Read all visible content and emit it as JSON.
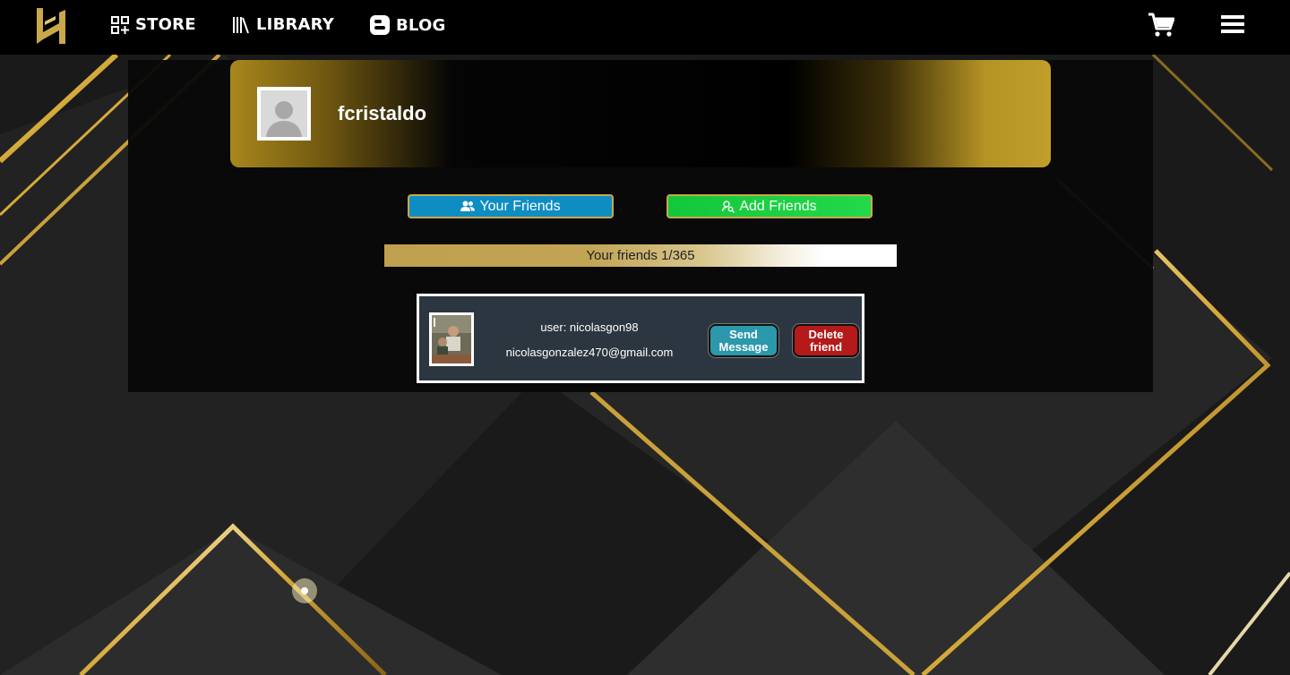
{
  "nav": {
    "store_label": "STORE",
    "library_label": "LIBRARY",
    "blog_label": "BLOG"
  },
  "profile": {
    "username": "fcristaldo"
  },
  "tabs": {
    "your_friends_label": "Your Friends",
    "add_friends_label": "Add Friends"
  },
  "friends_count": {
    "text": "Your friends 1/365"
  },
  "friends": [
    {
      "user_line": "user: nicolasgon98",
      "email": "nicolasgonzalez470@gmail.com",
      "send_label": "Send Message",
      "delete_label": "Delete friend"
    }
  ],
  "colors": {
    "accent_gold": "#c19e2a",
    "your_friends_blue": "#0e8dc3",
    "add_friends_green": "#14c73a",
    "send_teal": "#2b98ab",
    "delete_red": "#b51a1a"
  }
}
